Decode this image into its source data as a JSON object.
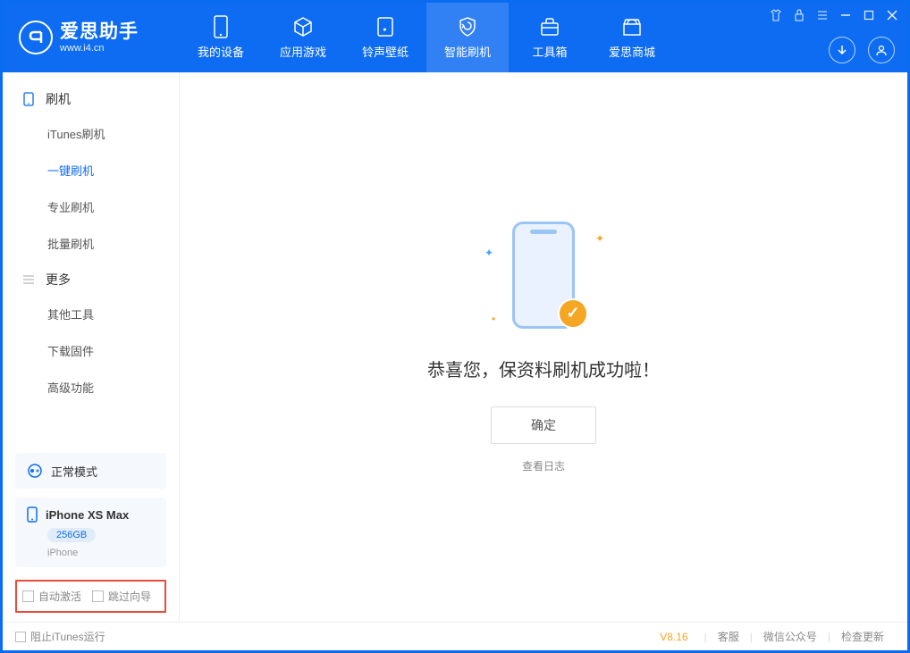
{
  "app": {
    "name": "爱思助手",
    "url": "www.i4.cn"
  },
  "header_tabs": [
    {
      "label": "我的设备"
    },
    {
      "label": "应用游戏"
    },
    {
      "label": "铃声壁纸"
    },
    {
      "label": "智能刷机"
    },
    {
      "label": "工具箱"
    },
    {
      "label": "爱思商城"
    }
  ],
  "sidebar": {
    "section1": {
      "title": "刷机",
      "items": [
        {
          "label": "iTunes刷机"
        },
        {
          "label": "一键刷机"
        },
        {
          "label": "专业刷机"
        },
        {
          "label": "批量刷机"
        }
      ]
    },
    "section2": {
      "title": "更多",
      "items": [
        {
          "label": "其他工具"
        },
        {
          "label": "下载固件"
        },
        {
          "label": "高级功能"
        }
      ]
    },
    "mode": "正常模式",
    "device": {
      "name": "iPhone XS Max",
      "capacity": "256GB",
      "type": "iPhone"
    },
    "checkbox1": "自动激活",
    "checkbox2": "跳过向导"
  },
  "main": {
    "message": "恭喜您，保资料刷机成功啦！",
    "ok": "确定",
    "log": "查看日志"
  },
  "footer": {
    "block_itunes": "阻止iTunes运行",
    "version": "V8.16",
    "service": "客服",
    "wechat": "微信公众号",
    "update": "检查更新"
  }
}
